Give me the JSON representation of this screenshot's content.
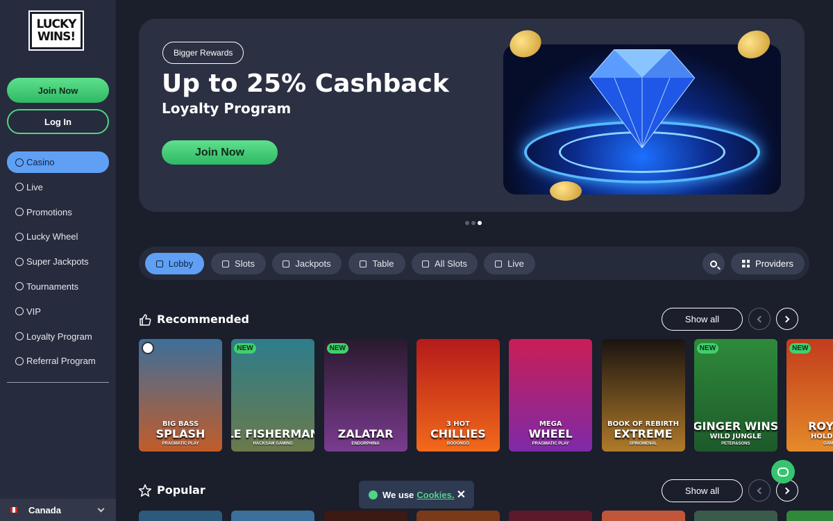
{
  "brand": {
    "logo_line1": "LUCKY",
    "logo_line2": "WINS!"
  },
  "sidebar": {
    "join_label": "Join Now",
    "login_label": "Log In",
    "items": [
      {
        "label": "Casino",
        "icon": "casino-icon"
      },
      {
        "label": "Live",
        "icon": "live-icon"
      },
      {
        "label": "Promotions",
        "icon": "gift-icon"
      },
      {
        "label": "Lucky Wheel",
        "icon": "wheel-icon"
      },
      {
        "label": "Super Jackpots",
        "icon": "jackpot-icon"
      },
      {
        "label": "Tournaments",
        "icon": "trophy-icon"
      },
      {
        "label": "VIP",
        "icon": "vip-icon"
      },
      {
        "label": "Loyalty Program",
        "icon": "loyalty-icon"
      },
      {
        "label": "Referral Program",
        "icon": "referral-icon"
      }
    ],
    "active_index": 0,
    "country": "Canada"
  },
  "hero": {
    "badge": "Bigger Rewards",
    "title": "Up to 25% Cashback",
    "subtitle": "Loyalty Program",
    "cta": "Join Now",
    "slides": 3,
    "active_slide": 3
  },
  "categories": {
    "tabs": [
      "Lobby",
      "Slots",
      "Jackpots",
      "Table",
      "All Slots",
      "Live"
    ],
    "active_index": 0,
    "providers_label": "Providers"
  },
  "sections": [
    {
      "title": "Recommended",
      "show_all": "Show all"
    },
    {
      "title": "Popular",
      "show_all": "Show all"
    }
  ],
  "games": [
    {
      "line1": "BIG BASS",
      "line2": "SPLASH",
      "provider": "PRAGMATIC PLAY",
      "badge": "",
      "colors": [
        "#3d6f9a",
        "#c25c2a"
      ]
    },
    {
      "line1": "",
      "line2": "LE FISHERMAN",
      "provider": "HACKSAW GAMING",
      "badge": "NEW",
      "colors": [
        "#2d7d8c",
        "#6b7a4a"
      ]
    },
    {
      "line1": "",
      "line2": "ZALATAR",
      "provider": "ENDORPHINA",
      "badge": "NEW",
      "colors": [
        "#2a1a2e",
        "#7a3b8f"
      ]
    },
    {
      "line1": "3 HOT",
      "line2": "CHILLIES",
      "provider": "BOOONGO",
      "badge": "",
      "colors": [
        "#b51a1a",
        "#f26a1b"
      ]
    },
    {
      "line1": "MEGA",
      "line2": "WHEEL",
      "provider": "PRAGMATIC PLAY",
      "badge": "",
      "colors": [
        "#c91e55",
        "#7e2aa8"
      ]
    },
    {
      "line1": "BOOK OF REBIRTH",
      "line2": "EXTREME",
      "provider": "SPINOMENAL",
      "badge": "",
      "colors": [
        "#1a1410",
        "#b07a2a"
      ]
    },
    {
      "line1": "",
      "line2": "GINGER WINS",
      "provider": "PETER&SONS",
      "badge": "NEW",
      "colors": [
        "#2e8a3a",
        "#1d5a2a"
      ],
      "line2b": "WILD JUNGLE"
    },
    {
      "line1": "",
      "line2": "ROYAL",
      "provider": "GAM",
      "badge": "NEW",
      "colors": [
        "#c23c1c",
        "#e58a2a"
      ],
      "line2b": "HOLD TH"
    }
  ],
  "cookie": {
    "text": "We use",
    "link": "Cookies."
  },
  "colors": {
    "accent_green": "#4fd584",
    "active_blue": "#5fa0f4",
    "bg": "#1b1e2b"
  }
}
